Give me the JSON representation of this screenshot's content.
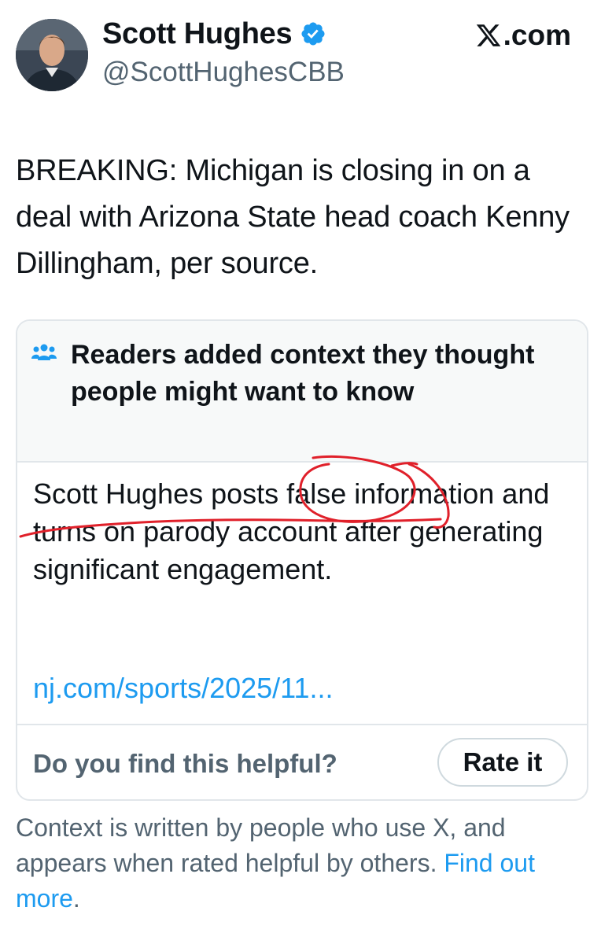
{
  "author": {
    "name": "Scott Hughes",
    "handle": "@ScottHughesCBB",
    "verified_icon": "verified-badge-icon"
  },
  "site": {
    "label": ".com",
    "logo_icon": "x-logo-icon"
  },
  "tweet": {
    "text": "BREAKING: Michigan is closing in on a deal with Arizona State head coach Kenny Dillingham, per source."
  },
  "community_note": {
    "header_icon": "people-icon",
    "header": "Readers added context they thought people might want to know",
    "body": "Scott Hughes posts false information and turns on parody account after generating significant engagement.",
    "link_text": "nj.com/sports/2025/11...",
    "helpful_question": "Do you find this helpful?",
    "rate_button": "Rate it"
  },
  "footer": {
    "text": "Context is written by people who use X, and appears when rated helpful by others.",
    "link": "Find out more",
    "trailing": "."
  },
  "colors": {
    "link_blue": "#1d9bf0",
    "secondary_text": "#536471",
    "verified_blue": "#1d9bf0",
    "annotation_red": "#e0202a"
  }
}
